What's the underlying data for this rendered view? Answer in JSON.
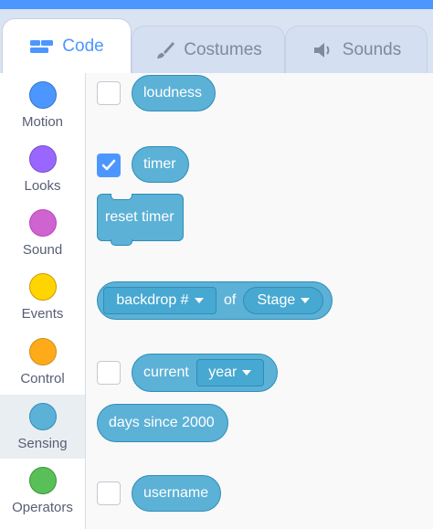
{
  "tabs": [
    {
      "label": "Code",
      "icon": "code-icon"
    },
    {
      "label": "Costumes",
      "icon": "brush-icon"
    },
    {
      "label": "Sounds",
      "icon": "speaker-icon"
    }
  ],
  "categories": [
    {
      "label": "Motion",
      "color": "#4c97ff"
    },
    {
      "label": "Looks",
      "color": "#9966ff"
    },
    {
      "label": "Sound",
      "color": "#cf63cf"
    },
    {
      "label": "Events",
      "color": "#ffd500"
    },
    {
      "label": "Control",
      "color": "#ffab19"
    },
    {
      "label": "Sensing",
      "color": "#5cb1d6"
    },
    {
      "label": "Operators",
      "color": "#59c059"
    }
  ],
  "selected_category": "Sensing",
  "blocks": {
    "loudness": {
      "label": "loudness",
      "checked": false
    },
    "timer": {
      "label": "timer",
      "checked": true
    },
    "reset_timer": {
      "label": "reset timer"
    },
    "backdrop": {
      "menu": "backdrop #",
      "of": "of",
      "target": "Stage"
    },
    "current": {
      "label": "current",
      "menu": "year",
      "checked": false
    },
    "days_since": {
      "label": "days since 2000"
    },
    "username": {
      "label": "username",
      "checked": false
    }
  }
}
